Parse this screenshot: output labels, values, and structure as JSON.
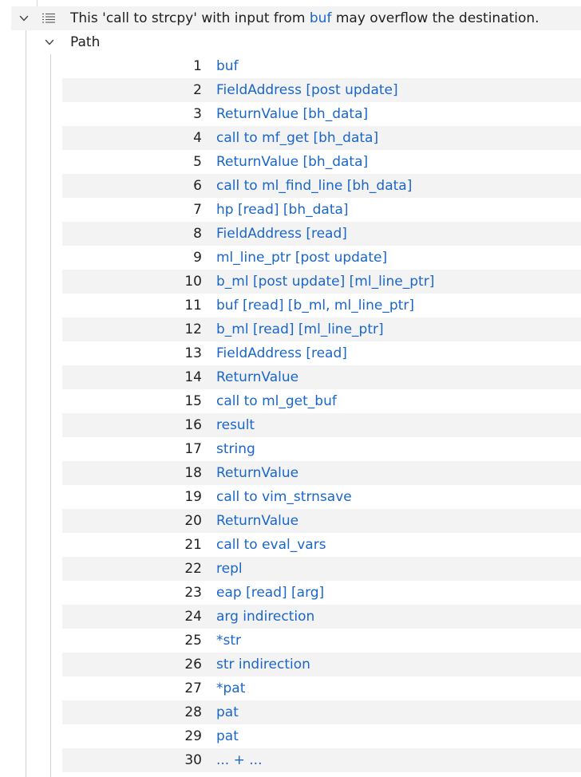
{
  "alert": {
    "message_prefix": "This 'call to strcpy' with input from ",
    "source_link": "buf",
    "message_suffix": " may overflow the destination."
  },
  "path": {
    "label": "Path",
    "steps": [
      {
        "number": "1",
        "label": "buf"
      },
      {
        "number": "2",
        "label": "FieldAddress [post update]"
      },
      {
        "number": "3",
        "label": "ReturnValue [bh_data]"
      },
      {
        "number": "4",
        "label": "call to mf_get [bh_data]"
      },
      {
        "number": "5",
        "label": "ReturnValue [bh_data]"
      },
      {
        "number": "6",
        "label": "call to ml_find_line [bh_data]"
      },
      {
        "number": "7",
        "label": "hp [read] [bh_data]"
      },
      {
        "number": "8",
        "label": "FieldAddress [read]"
      },
      {
        "number": "9",
        "label": "ml_line_ptr [post update]"
      },
      {
        "number": "10",
        "label": "b_ml [post update] [ml_line_ptr]"
      },
      {
        "number": "11",
        "label": "buf [read] [b_ml, ml_line_ptr]"
      },
      {
        "number": "12",
        "label": "b_ml [read] [ml_line_ptr]"
      },
      {
        "number": "13",
        "label": "FieldAddress [read]"
      },
      {
        "number": "14",
        "label": "ReturnValue"
      },
      {
        "number": "15",
        "label": "call to ml_get_buf"
      },
      {
        "number": "16",
        "label": "result"
      },
      {
        "number": "17",
        "label": "string"
      },
      {
        "number": "18",
        "label": "ReturnValue"
      },
      {
        "number": "19",
        "label": "call to vim_strnsave"
      },
      {
        "number": "20",
        "label": "ReturnValue"
      },
      {
        "number": "21",
        "label": "call to eval_vars"
      },
      {
        "number": "22",
        "label": "repl"
      },
      {
        "number": "23",
        "label": "eap [read] [arg]"
      },
      {
        "number": "24",
        "label": "arg indirection"
      },
      {
        "number": "25",
        "label": "*str"
      },
      {
        "number": "26",
        "label": "str indirection"
      },
      {
        "number": "27",
        "label": "*pat"
      },
      {
        "number": "28",
        "label": "pat"
      },
      {
        "number": "29",
        "label": "pat"
      },
      {
        "number": "30",
        "label": "... + ..."
      }
    ]
  },
  "icons": {
    "alert_chevron": "chevron-down-icon",
    "alert_list": "list-icon",
    "path_chevron": "chevron-down-icon"
  },
  "colors": {
    "link": "#1a66c9",
    "row_alt": "#f3f3f3",
    "text": "#1f1f1f"
  }
}
